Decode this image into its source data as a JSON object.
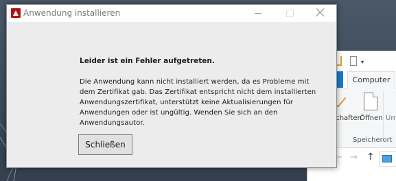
{
  "dialog": {
    "title": "Anwendung installieren",
    "heading": "Leider ist ein Fehler aufgetreten.",
    "message_lines": [
      "Die Anwendung kann nicht installiert werden, da es Probleme mit",
      "dem Zertifikat gab. Das Zertifikat entspricht nicht dem installierten",
      "Anwendungszertifikat, unterstützt keine Aktualisierungen für",
      "Anwendungen oder ist ungültig. Wenden Sie sich an den",
      "Anwendungsautor."
    ],
    "close_label": "Schließen",
    "accent": "#b20f0f"
  },
  "explorer": {
    "tab_computer": "Computer",
    "ribbon_items": [
      "schaften",
      "Öffnen",
      "Um"
    ],
    "group_label": "Speicherort",
    "accent": "#1979ca"
  }
}
